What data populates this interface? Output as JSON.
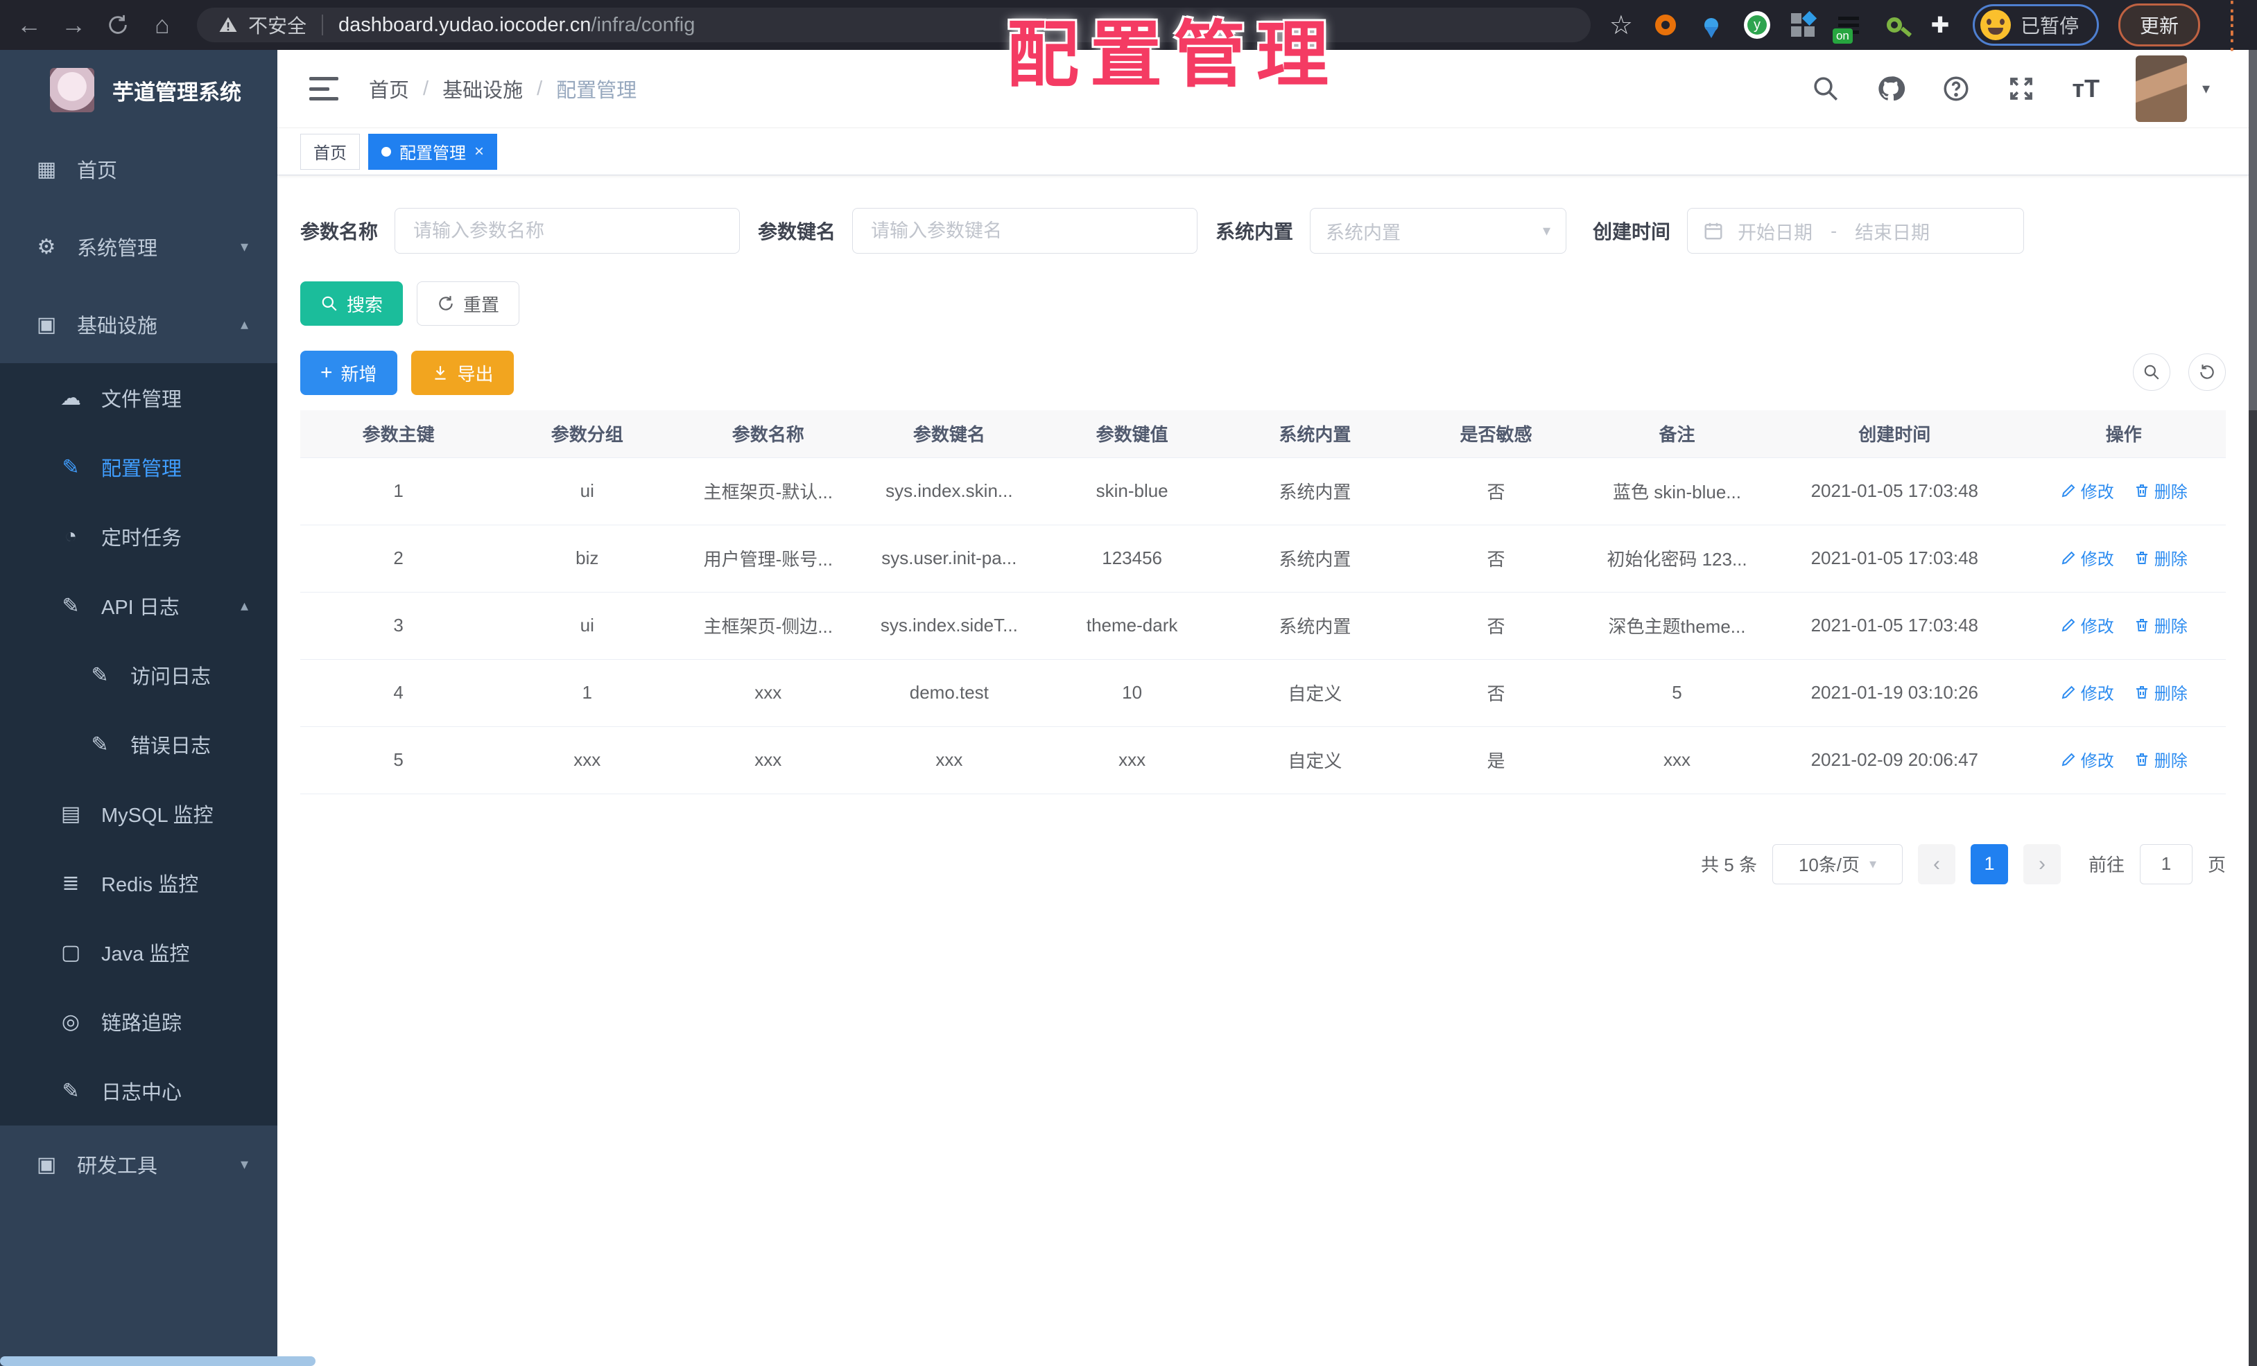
{
  "browser": {
    "security_label": "不安全",
    "url_host": "dashboard.yudao.iocoder.cn",
    "url_path": "/infra/config",
    "extension_badge": "on",
    "profile_status": "已暂停",
    "update_label": "更新"
  },
  "overlay_title": "配置管理",
  "sidebar": {
    "app_title": "芋道管理系统",
    "items": [
      {
        "label": "首页",
        "icon": "dashboard-icon",
        "level": 0,
        "submenu": false,
        "active": false
      },
      {
        "label": "系统管理",
        "icon": "gear-icon",
        "level": 0,
        "submenu": false,
        "active": false,
        "chevron": "down"
      },
      {
        "label": "基础设施",
        "icon": "infrastructure-icon",
        "level": 0,
        "submenu": false,
        "active": false,
        "chevron": "up"
      },
      {
        "label": "文件管理",
        "icon": "cloud-upload-icon",
        "level": 1,
        "submenu": true,
        "active": false
      },
      {
        "label": "配置管理",
        "icon": "edit-icon",
        "level": 1,
        "submenu": true,
        "active": true
      },
      {
        "label": "定时任务",
        "icon": "timer-icon",
        "level": 1,
        "submenu": true,
        "active": false
      },
      {
        "label": "API 日志",
        "icon": "log-icon",
        "level": 1,
        "submenu": true,
        "active": false,
        "chevron": "up"
      },
      {
        "label": "访问日志",
        "icon": "log-icon",
        "level": 2,
        "submenu": true,
        "active": false
      },
      {
        "label": "错误日志",
        "icon": "log-icon",
        "level": 2,
        "submenu": true,
        "active": false
      },
      {
        "label": "MySQL 监控",
        "icon": "database-icon",
        "level": 1,
        "submenu": true,
        "active": false
      },
      {
        "label": "Redis 监控",
        "icon": "stack-icon",
        "level": 1,
        "submenu": true,
        "active": false
      },
      {
        "label": "Java 监控",
        "icon": "monitor-icon",
        "level": 1,
        "submenu": true,
        "active": false
      },
      {
        "label": "链路追踪",
        "icon": "eye-icon",
        "level": 1,
        "submenu": true,
        "active": false
      },
      {
        "label": "日志中心",
        "icon": "log-icon",
        "level": 1,
        "submenu": true,
        "active": false
      },
      {
        "label": "研发工具",
        "icon": "toolbox-icon",
        "level": 0,
        "submenu": false,
        "active": false,
        "chevron": "down"
      }
    ]
  },
  "navbar": {
    "breadcrumb": [
      "首页",
      "基础设施",
      "配置管理"
    ]
  },
  "tabs": [
    {
      "label": "首页",
      "active": false,
      "closable": false
    },
    {
      "label": "配置管理",
      "active": true,
      "closable": true
    }
  ],
  "filters": {
    "name_label": "参数名称",
    "name_placeholder": "请输入参数名称",
    "key_label": "参数键名",
    "key_placeholder": "请输入参数键名",
    "type_label": "系统内置",
    "type_placeholder": "系统内置",
    "date_label": "创建时间",
    "date_start_placeholder": "开始日期",
    "date_separator": "-",
    "date_end_placeholder": "结束日期"
  },
  "toolbar": {
    "search": "搜索",
    "reset": "重置",
    "add": "新增",
    "export": "导出"
  },
  "table": {
    "columns": [
      "参数主键",
      "参数分组",
      "参数名称",
      "参数键名",
      "参数键值",
      "系统内置",
      "是否敏感",
      "备注",
      "创建时间",
      "操作"
    ],
    "action_modify": "修改",
    "action_delete": "删除",
    "rows": [
      [
        "1",
        "ui",
        "主框架页-默认...",
        "sys.index.skin...",
        "skin-blue",
        "系统内置",
        "否",
        "蓝色 skin-blue...",
        "2021-01-05 17:03:48"
      ],
      [
        "2",
        "biz",
        "用户管理-账号...",
        "sys.user.init-pa...",
        "123456",
        "系统内置",
        "否",
        "初始化密码 123...",
        "2021-01-05 17:03:48"
      ],
      [
        "3",
        "ui",
        "主框架页-侧边...",
        "sys.index.sideT...",
        "theme-dark",
        "系统内置",
        "否",
        "深色主题theme...",
        "2021-01-05 17:03:48"
      ],
      [
        "4",
        "1",
        "xxx",
        "demo.test",
        "10",
        "自定义",
        "否",
        "5",
        "2021-01-19 03:10:26"
      ],
      [
        "5",
        "xxx",
        "xxx",
        "xxx",
        "xxx",
        "自定义",
        "是",
        "xxx",
        "2021-02-09 20:06:47"
      ]
    ]
  },
  "pagination": {
    "total": "共 5 条",
    "page_size": "10条/页",
    "prev": "‹",
    "next": "›",
    "current_page": "1",
    "goto_label": "前往",
    "goto_value": "1",
    "page_unit": "页"
  },
  "colors": {
    "accent": "#2d8cf0",
    "search_button": "#1bbd9b",
    "export_button": "#f2a51f",
    "overlay_pink": "#f43b63",
    "sidebar_bg": "#304156",
    "submenu_bg": "#1f2d3d"
  }
}
